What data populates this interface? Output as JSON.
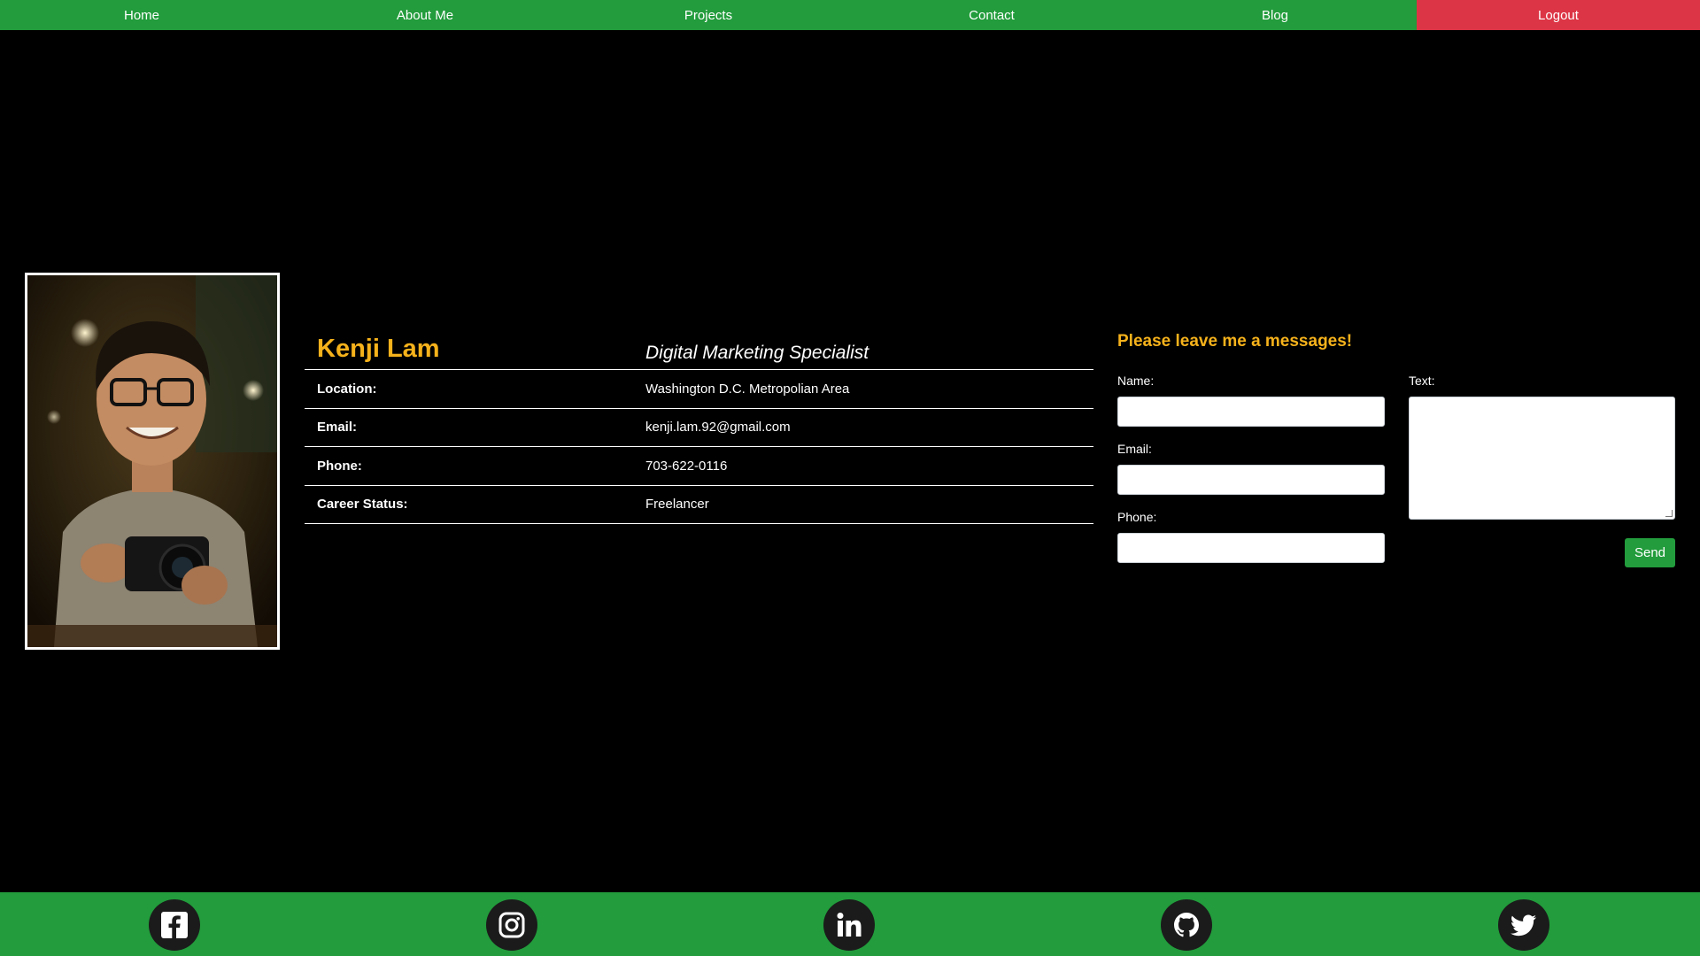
{
  "nav": {
    "items": [
      {
        "label": "Home"
      },
      {
        "label": "About Me"
      },
      {
        "label": "Projects"
      },
      {
        "label": "Contact"
      },
      {
        "label": "Blog"
      }
    ],
    "logout": "Logout"
  },
  "profile": {
    "name": "Kenji Lam",
    "job_title": "Digital Marketing Specialist",
    "rows": [
      {
        "label": "Location:",
        "value": "Washington D.C. Metropolian Area"
      },
      {
        "label": "Email:",
        "value": "kenji.lam.92@gmail.com"
      },
      {
        "label": "Phone:",
        "value": "703-622-0116"
      },
      {
        "label": "Career Status:",
        "value": "Freelancer"
      }
    ]
  },
  "form": {
    "title": "Please leave me a messages!",
    "name_label": "Name:",
    "email_label": "Email:",
    "phone_label": "Phone:",
    "text_label": "Text:",
    "name_value": "",
    "email_value": "",
    "phone_value": "",
    "text_value": "",
    "send_label": "Send"
  },
  "footer": {
    "icons": [
      "facebook-icon",
      "instagram-icon",
      "linkedin-icon",
      "github-icon",
      "twitter-icon"
    ]
  },
  "colors": {
    "nav_green": "#229c3c",
    "logout_red": "#dc3545",
    "accent_yellow": "#f6b21b",
    "background": "#000000"
  }
}
